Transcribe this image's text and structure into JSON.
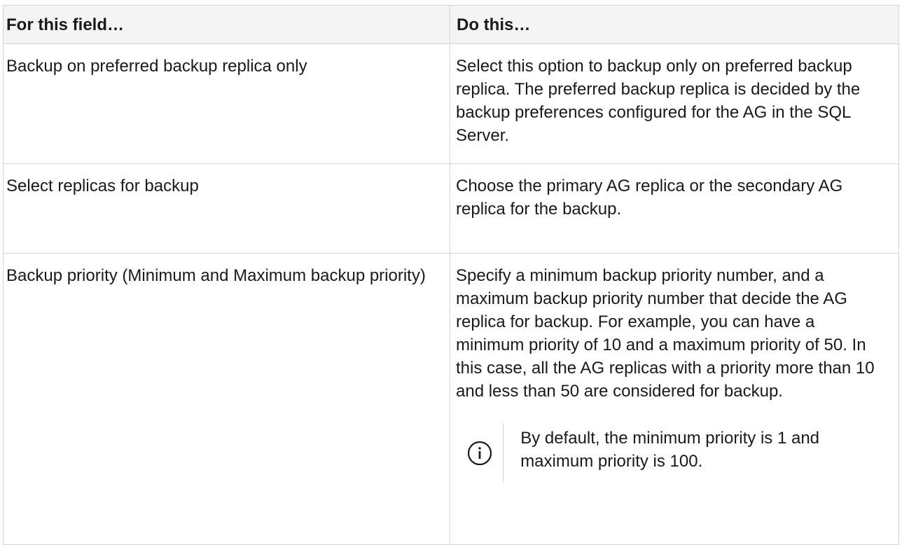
{
  "table": {
    "headers": [
      "For this field…",
      "Do this…"
    ],
    "rows": [
      {
        "field": "Backup on preferred backup replica only",
        "action": "Select this option to backup only on preferred backup replica. The preferred backup replica is decided by the backup preferences configured for the AG in the SQL Server."
      },
      {
        "field": "Select replicas for backup",
        "action": "Choose the primary AG replica or the secondary AG replica for the backup."
      },
      {
        "field": "Backup priority (Minimum and Maximum backup priority)",
        "action": "Specify a minimum backup priority number, and a maximum backup priority number that decide the AG replica for backup. For example, you can have a minimum priority of 10 and a maximum priority of 50. In this case, all the AG replicas with a priority more than 10 and less than 50 are considered for backup.",
        "note": {
          "icon": "info-icon",
          "text": "By default, the minimum priority is 1 and maximum priority is 100."
        }
      }
    ]
  },
  "colors": {
    "border": "#d4d4d4",
    "header_bg": "#f4f4f4",
    "icon": "#1a1a1a"
  }
}
